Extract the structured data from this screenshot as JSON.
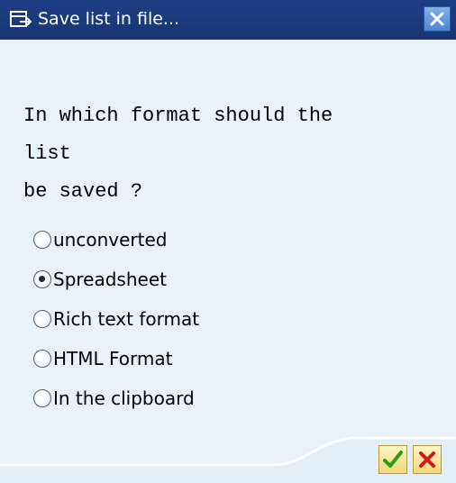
{
  "window": {
    "title": "Save list in file..."
  },
  "question": {
    "lines": [
      "In which format should the",
      "list",
      "be saved ?"
    ]
  },
  "options": [
    {
      "label": "unconverted",
      "selected": false
    },
    {
      "label": "Spreadsheet",
      "selected": true
    },
    {
      "label": "Rich text format",
      "selected": false
    },
    {
      "label": "HTML Format",
      "selected": false
    },
    {
      "label": "In the clipboard",
      "selected": false
    }
  ],
  "icons": {
    "title": "save-list-icon",
    "close": "close-icon",
    "ok": "checkmark-icon",
    "cancel": "cancel-x-icon"
  },
  "colors": {
    "titlebar": "#1e3f86",
    "dialog_background": "#e9f2f8",
    "ok_check": "#2f9a12",
    "cancel_x": "#d01919"
  }
}
